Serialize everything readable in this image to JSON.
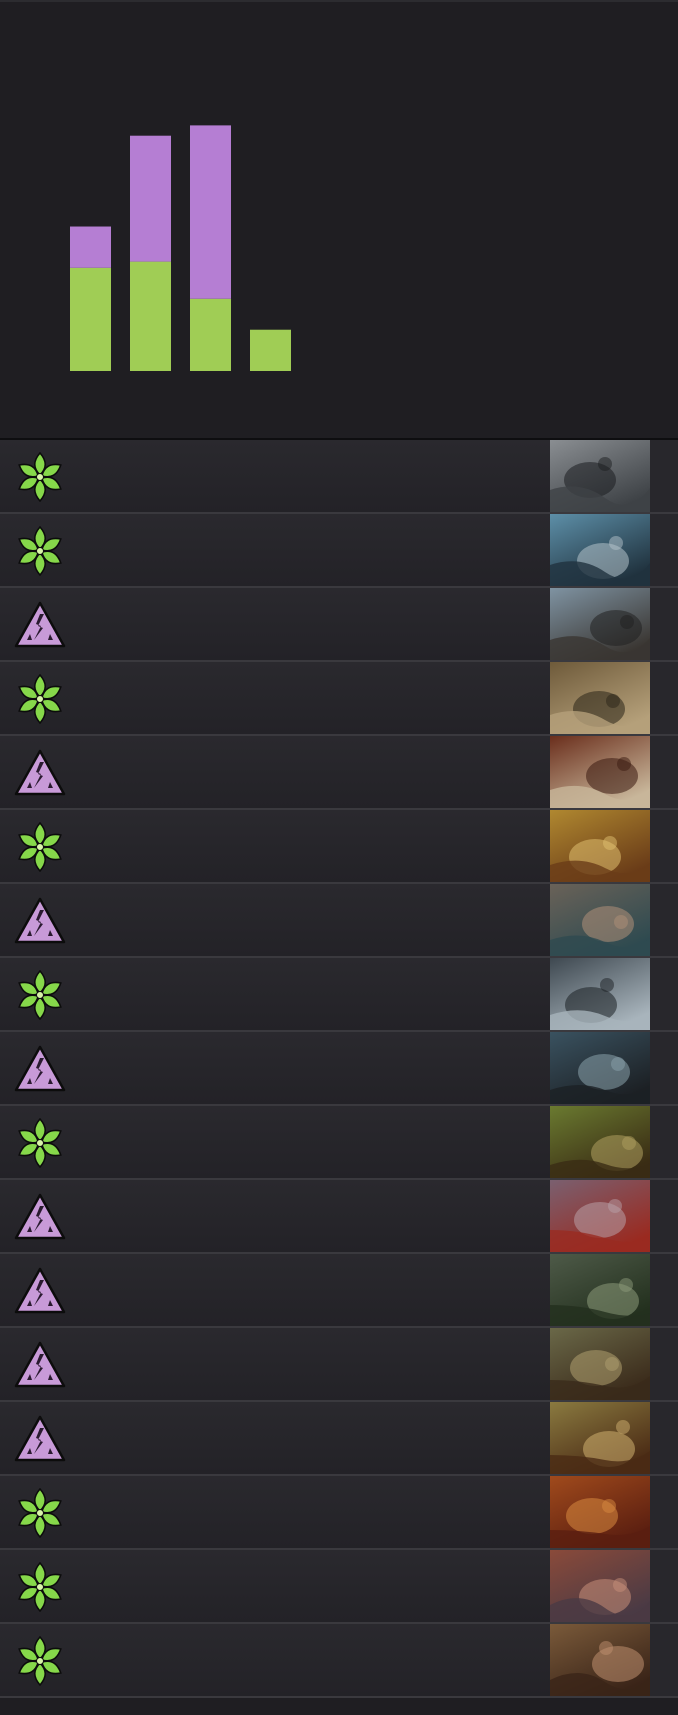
{
  "chart_data": {
    "type": "bar",
    "stacked": true,
    "categories": [
      "",
      "",
      "",
      ""
    ],
    "series": [
      {
        "color": "#a0cd55",
        "values": [
          5,
          5.3,
          3.5,
          2
        ]
      },
      {
        "color": "#b57ed3",
        "values": [
          2,
          6.1,
          8.4,
          0
        ]
      }
    ],
    "ylim": [
      0,
      12.5
    ],
    "grid": false
  },
  "cards": [
    {
      "type": "green",
      "art": "hooded-rider"
    },
    {
      "type": "green",
      "art": "serpent-maw"
    },
    {
      "type": "purple",
      "art": "howling-wolf"
    },
    {
      "type": "green",
      "art": "giant-rat"
    },
    {
      "type": "purple",
      "art": "skull"
    },
    {
      "type": "green",
      "art": "golden-warrior"
    },
    {
      "type": "purple",
      "art": "rat-rider"
    },
    {
      "type": "green",
      "art": "moon-wolf"
    },
    {
      "type": "purple",
      "art": "dark-knight"
    },
    {
      "type": "green",
      "art": "leaping-beast"
    },
    {
      "type": "purple",
      "art": "giant-insect"
    },
    {
      "type": "purple",
      "art": "swamp-crawler"
    },
    {
      "type": "purple",
      "art": "goblin-scout"
    },
    {
      "type": "purple",
      "art": "treasure-guard"
    },
    {
      "type": "green",
      "art": "fire-brute"
    },
    {
      "type": "green",
      "art": "red-mage"
    },
    {
      "type": "green",
      "art": "clay-ogre"
    }
  ],
  "colors": {
    "green_icon": "#86d84a",
    "purple_icon": "#c89ad8",
    "background": "#1f1e22"
  }
}
